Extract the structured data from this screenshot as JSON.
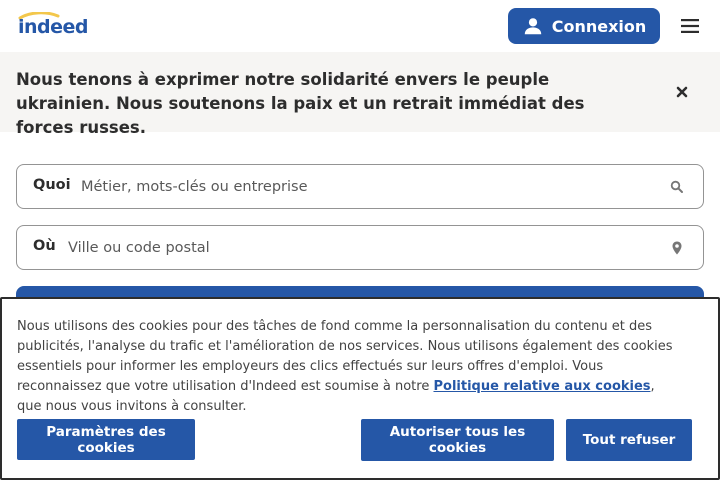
{
  "header": {
    "logo_text": "indeed",
    "login_label": "Connexion",
    "login_icon": "person-icon",
    "menu_icon": "hamburger-menu-icon"
  },
  "banner": {
    "text": "Nous tenons à exprimer notre solidarité envers le peuple ukrainien. Nous soutenons la paix et un retrait immédiat des forces russes.",
    "close_icon": "close-icon"
  },
  "search": {
    "what_label": "Quoi",
    "what_placeholder": "Métier, mots-clés ou entreprise",
    "what_icon": "search-icon",
    "where_label": "Où",
    "where_placeholder": "Ville ou code postal",
    "where_icon": "location-pin-icon"
  },
  "cookies": {
    "text_before": "Nous utilisons des cookies pour des tâches de fond comme la personnalisation du contenu et des publicités, l'analyse du trafic et l'amélioration de nos services. Nous utilisons également des cookies essentiels pour informer les employeurs des clics effectués sur leurs offres d'emploi. Vous reconnaissez que votre utilisation d'Indeed est soumise à notre ",
    "link_label": "Politique relative aux cookies",
    "text_after": ", que nous vous invitons à consulter.",
    "settings_label": "Paramètres des cookies",
    "accept_label": "Autoriser tous les cookies",
    "refuse_label": "Tout refuser"
  },
  "colors": {
    "brand_blue": "#2557a7",
    "logo_yellow": "#f3c74b",
    "banner_bg": "#f6f5f3"
  }
}
